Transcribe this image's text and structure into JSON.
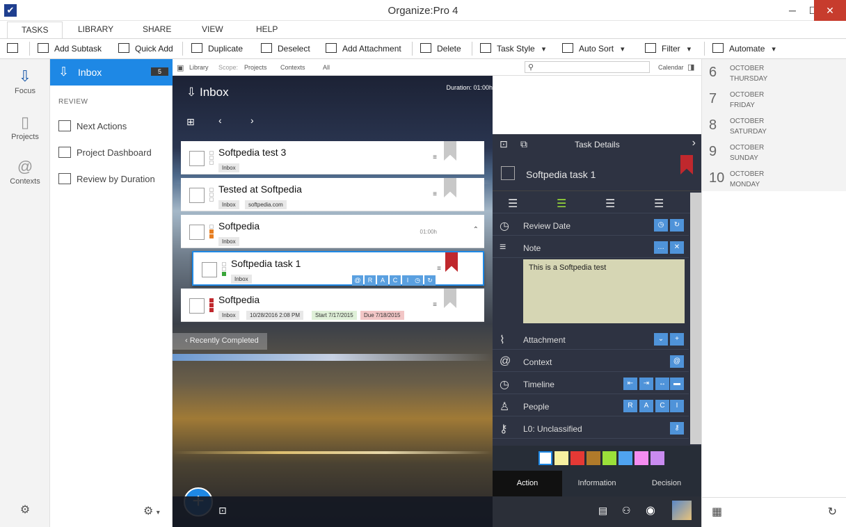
{
  "window": {
    "title": "Organize:Pro 4"
  },
  "ribbon_tabs": [
    {
      "label": "TASKS"
    },
    {
      "label": "LIBRARY"
    },
    {
      "label": "SHARE"
    },
    {
      "label": "VIEW"
    },
    {
      "label": "HELP"
    }
  ],
  "toolbar": {
    "add_subtask": "Add Subtask",
    "quick_add": "Quick Add",
    "duplicate": "Duplicate",
    "deselect": "Deselect",
    "add_attachment": "Add Attachment",
    "delete": "Delete",
    "task_style": "Task Style",
    "auto_sort": "Auto Sort",
    "filter": "Filter",
    "automate": "Automate"
  },
  "rail": [
    {
      "label": "Focus"
    },
    {
      "label": "Projects"
    },
    {
      "label": "Contexts"
    }
  ],
  "nav": {
    "inbox_label": "Inbox",
    "inbox_count": "5",
    "review_header": "REVIEW",
    "items": [
      {
        "label": "Next Actions"
      },
      {
        "label": "Project Dashboard"
      },
      {
        "label": "Review by Duration"
      }
    ]
  },
  "scope": {
    "library": "Library",
    "scope_label": "Scope:",
    "projects": "Projects",
    "contexts": "Contexts",
    "all": "All",
    "calendar": "Calendar"
  },
  "main": {
    "title": "Inbox",
    "duration": "Duration: 01:00h",
    "recently_completed": "Recently Completed"
  },
  "tasks": [
    {
      "title": "Softpedia test 3",
      "chips": [
        "Inbox"
      ]
    },
    {
      "title": "Tested at Softpedia",
      "chips": [
        "Inbox",
        "softpedia.com"
      ]
    },
    {
      "title": "Softpedia",
      "chips": [
        "Inbox"
      ],
      "time": "01:00h"
    },
    {
      "title": "Softpedia task 1",
      "chips": [
        "Inbox"
      ]
    },
    {
      "title": "Softpedia",
      "chips": [
        "Inbox",
        "10/28/2016 2:08 PM",
        "Start 7/17/2015",
        "Due 7/18/2015"
      ]
    }
  ],
  "raci": [
    "@",
    "R",
    "A",
    "C",
    "I"
  ],
  "details": {
    "header": "Task Details",
    "task_title": "Softpedia task 1",
    "review_date": "Review Date",
    "note_label": "Note",
    "note_text": "This is a Softpedia test",
    "attachment": "Attachment",
    "context": "Context",
    "timeline": "Timeline",
    "people": "People",
    "classification": "L0: Unclassified",
    "tabs": [
      {
        "label": "Action"
      },
      {
        "label": "Information"
      },
      {
        "label": "Decision"
      }
    ]
  },
  "swatches": [
    "#ffffff",
    "#f7f0a0",
    "#e53935",
    "#b07a2a",
    "#9be03a",
    "#4fa3f0",
    "#f48cf0",
    "#c98bf0"
  ],
  "people_buttons": [
    "R",
    "A",
    "C",
    "I"
  ],
  "calendar": [
    {
      "day": "6",
      "month": "OCTOBER",
      "weekday": "THURSDAY"
    },
    {
      "day": "7",
      "month": "OCTOBER",
      "weekday": "FRIDAY"
    },
    {
      "day": "8",
      "month": "OCTOBER",
      "weekday": "SATURDAY"
    },
    {
      "day": "9",
      "month": "OCTOBER",
      "weekday": "SUNDAY"
    },
    {
      "day": "10",
      "month": "OCTOBER",
      "weekday": "MONDAY"
    }
  ],
  "accent": "#1e88e5"
}
